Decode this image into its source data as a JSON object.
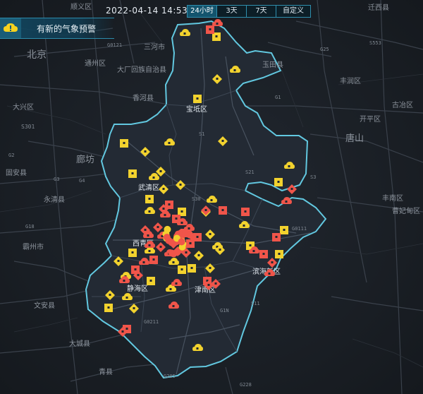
{
  "header": {
    "time": "2022-04-14 14:53:32",
    "tabs": [
      {
        "label": "24小时",
        "active": true
      },
      {
        "label": "3天",
        "active": false
      },
      {
        "label": "7天",
        "active": false
      },
      {
        "label": "自定义",
        "active": false
      }
    ]
  },
  "alert": {
    "text": "有新的气象预警",
    "icon": "cloud-warning-icon"
  },
  "map": {
    "colors": {
      "region_fill": "#232a34",
      "region_border": "#62c8e0",
      "marker_yellow": "#f2d22e",
      "marker_red": "#f0554a"
    },
    "city_labels": [
      "顺义区",
      "迁西县",
      "北京",
      "通州区",
      "大兴区",
      "廊坊",
      "固安县",
      "永清县",
      "霸州市",
      "文安县",
      "大城县",
      "青县",
      "唐山",
      "丰润区",
      "开平区",
      "古冶区",
      "丰南区",
      "曹妃甸区",
      "玉田县",
      "三河市",
      "香河县",
      "大厂回族自治县",
      "S301"
    ],
    "district_labels": [
      "宝坻区",
      "武清区",
      "西青区",
      "静海区",
      "津南区",
      "滨海新区"
    ],
    "road_labels": [
      "G0121",
      "G1",
      "S1",
      "S30",
      "S21",
      "G25",
      "G0111",
      "G0211",
      "G205",
      "G228",
      "S11",
      "G18",
      "G2",
      "G3",
      "G4",
      "S553",
      "G1N",
      "S3"
    ]
  }
}
